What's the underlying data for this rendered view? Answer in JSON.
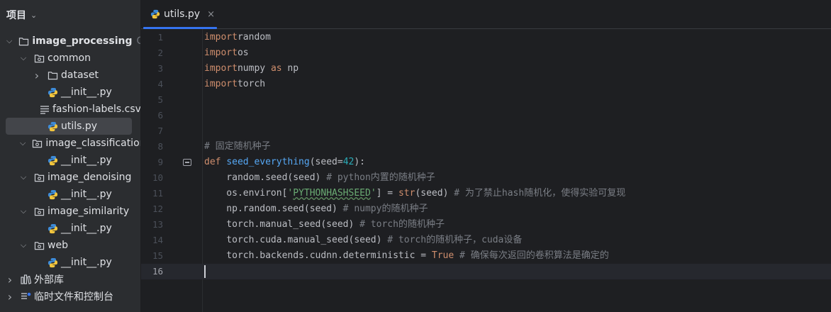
{
  "project_panel": {
    "title": "项目",
    "tree": [
      {
        "name": "tree-root-image-processing",
        "kind": "folder",
        "label": "image_processing",
        "hint": "C:\\U",
        "indent": 0,
        "expanded": true,
        "bold": true
      },
      {
        "name": "tree-folder-common",
        "kind": "package",
        "label": "common",
        "indent": 1,
        "expanded": true
      },
      {
        "name": "tree-folder-dataset",
        "kind": "folder",
        "label": "dataset",
        "indent": 2,
        "expanded": false
      },
      {
        "name": "tree-file-common-init",
        "kind": "python",
        "label": "__init__.py",
        "indent": 2
      },
      {
        "name": "tree-file-fashion-labels",
        "kind": "text",
        "label": "fashion-labels.csv",
        "indent": 2
      },
      {
        "name": "tree-file-utils",
        "kind": "python",
        "label": "utils.py",
        "indent": 2,
        "selected": true
      },
      {
        "name": "tree-folder-image-classification",
        "kind": "package",
        "label": "image_classification",
        "indent": 1,
        "expanded": true
      },
      {
        "name": "tree-file-classification-init",
        "kind": "python",
        "label": "__init__.py",
        "indent": 2
      },
      {
        "name": "tree-folder-image-denoising",
        "kind": "package",
        "label": "image_denoising",
        "indent": 1,
        "expanded": true
      },
      {
        "name": "tree-file-denoising-init",
        "kind": "python",
        "label": "__init__.py",
        "indent": 2
      },
      {
        "name": "tree-folder-image-similarity",
        "kind": "package",
        "label": "image_similarity",
        "indent": 1,
        "expanded": true
      },
      {
        "name": "tree-file-similarity-init",
        "kind": "python",
        "label": "__init__.py",
        "indent": 2
      },
      {
        "name": "tree-folder-web",
        "kind": "package",
        "label": "web",
        "indent": 1,
        "expanded": true
      },
      {
        "name": "tree-file-web-init",
        "kind": "python",
        "label": "__init__.py",
        "indent": 2
      },
      {
        "name": "tree-external-libraries",
        "kind": "library",
        "label": "外部库",
        "indent": 0,
        "expanded": false
      },
      {
        "name": "tree-scratches-consoles",
        "kind": "scratch",
        "label": "临时文件和控制台",
        "indent": 0,
        "expanded": false
      }
    ]
  },
  "editor": {
    "tab": {
      "label": "utils.py",
      "close": "×"
    },
    "current_line": 16,
    "lines": [
      [
        [
          "kw",
          "import"
        ],
        [
          "",
          "random"
        ]
      ],
      [
        [
          "kw",
          "import"
        ],
        [
          "",
          "os"
        ]
      ],
      [
        [
          "kw",
          "import"
        ],
        [
          "",
          "numpy "
        ],
        [
          "kw",
          "as"
        ],
        [
          "",
          " np"
        ]
      ],
      [
        [
          "kw",
          "import"
        ],
        [
          "",
          "torch"
        ]
      ],
      [],
      [],
      [],
      [
        [
          "cm",
          "# 固定随机种子"
        ]
      ],
      [
        [
          "kw",
          "def "
        ],
        [
          "fn",
          "seed_everything"
        ],
        [
          "",
          "(seed="
        ],
        [
          "num",
          "42"
        ],
        [
          "",
          "):"
        ]
      ],
      [
        [
          "",
          "    random.seed(seed) "
        ],
        [
          "cm",
          "# python内置的随机种子"
        ]
      ],
      [
        [
          "",
          "    os.environ["
        ],
        [
          "str",
          "'"
        ],
        [
          "str typo",
          "PYTHONHASHSEED"
        ],
        [
          "str",
          "'"
        ],
        [
          "",
          "] = "
        ],
        [
          "kw",
          "str"
        ],
        [
          "",
          "(seed) "
        ],
        [
          "cm",
          "# 为了禁止hash随机化，使得实验可复现"
        ]
      ],
      [
        [
          "",
          "    np.random.seed(seed) "
        ],
        [
          "cm",
          "# numpy的随机种子"
        ]
      ],
      [
        [
          "",
          "    torch.manual_seed(seed) "
        ],
        [
          "cm",
          "# torch的随机种子"
        ]
      ],
      [
        [
          "",
          "    torch.cuda.manual_seed(seed) "
        ],
        [
          "cm",
          "# torch的随机种子，cuda设备"
        ]
      ],
      [
        [
          "",
          "    torch.backends.cudnn.deterministic = "
        ],
        [
          "kw",
          "True"
        ],
        [
          "",
          " "
        ],
        [
          "cm",
          "# 确保每次返回的卷积算法是确定的"
        ]
      ],
      []
    ]
  },
  "icons": {
    "folder": "folder-icon",
    "package": "package-folder-icon",
    "python": "python-file-icon",
    "text": "text-file-icon",
    "library": "library-icon",
    "scratch": "scratch-icon"
  }
}
